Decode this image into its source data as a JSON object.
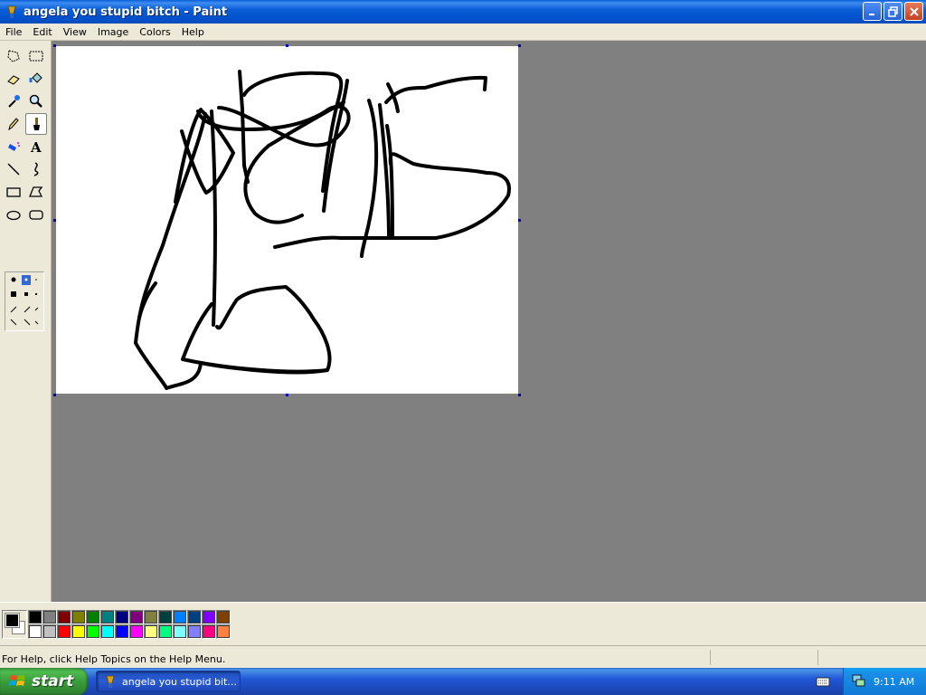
{
  "window": {
    "title": "angela you stupid bitch - Paint",
    "controls": [
      "minimize",
      "maximize",
      "close"
    ]
  },
  "menu": [
    "File",
    "Edit",
    "View",
    "Image",
    "Colors",
    "Help"
  ],
  "tools": [
    {
      "name": "free-form-select",
      "icon": "free-form-select-icon",
      "active": false
    },
    {
      "name": "select",
      "icon": "rect-select-icon",
      "active": false
    },
    {
      "name": "eraser",
      "icon": "eraser-icon",
      "active": false
    },
    {
      "name": "fill",
      "icon": "fill-bucket-icon",
      "active": false
    },
    {
      "name": "pick-color",
      "icon": "eyedropper-icon",
      "active": false
    },
    {
      "name": "magnifier",
      "icon": "magnifier-icon",
      "active": false
    },
    {
      "name": "pencil",
      "icon": "pencil-icon",
      "active": false
    },
    {
      "name": "brush",
      "icon": "brush-icon",
      "active": true
    },
    {
      "name": "airbrush",
      "icon": "airbrush-icon",
      "active": false
    },
    {
      "name": "text",
      "icon": "text-icon",
      "active": false
    },
    {
      "name": "line",
      "icon": "line-icon",
      "active": false
    },
    {
      "name": "curve",
      "icon": "curve-icon",
      "active": false
    },
    {
      "name": "rectangle",
      "icon": "rectangle-icon",
      "active": false
    },
    {
      "name": "polygon",
      "icon": "polygon-icon",
      "active": false
    },
    {
      "name": "ellipse",
      "icon": "ellipse-icon",
      "active": false
    },
    {
      "name": "rounded-rectangle",
      "icon": "rounded-rectangle-icon",
      "active": false
    }
  ],
  "colors": {
    "foreground": "#000000",
    "background": "#ffffff",
    "palette_top": [
      "#000000",
      "#808080",
      "#800000",
      "#808000",
      "#008000",
      "#008080",
      "#000080",
      "#800080",
      "#808040",
      "#004040",
      "#0080ff",
      "#004080",
      "#8000ff",
      "#804000"
    ],
    "palette_bottom": [
      "#ffffff",
      "#c0c0c0",
      "#ff0000",
      "#ffff00",
      "#00ff00",
      "#00ffff",
      "#0000ff",
      "#ff00ff",
      "#ffff80",
      "#00ff80",
      "#80ffff",
      "#8080ff",
      "#ff0080",
      "#ff8040"
    ]
  },
  "status": {
    "help_text": "For Help, click Help Topics on the Help Menu."
  },
  "taskbar": {
    "start_label": "start",
    "task_label": "angela you stupid bit...",
    "clock": "9:11 AM"
  }
}
